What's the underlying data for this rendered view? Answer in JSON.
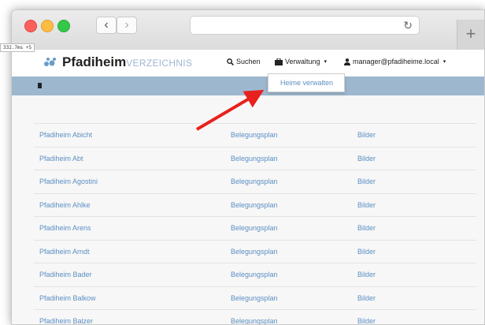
{
  "timing": "332.7ms +5",
  "logo": {
    "main": "Pfadiheim",
    "sub": "VERZEICHNIS"
  },
  "nav": {
    "search": "Suchen",
    "admin": "Verwaltung",
    "user": "manager@pfadiheime.local"
  },
  "dropdown": {
    "item": "Heime verwalten"
  },
  "rows": [
    {
      "name": "Pfadiheim Abicht",
      "plan": "Belegungsplan",
      "pics": "Bilder"
    },
    {
      "name": "Pfadiheim Abt",
      "plan": "Belegungsplan",
      "pics": "Bilder"
    },
    {
      "name": "Pfadiheim Agostini",
      "plan": "Belegungsplan",
      "pics": "Bilder"
    },
    {
      "name": "Pfadiheim Ahlke",
      "plan": "Belegungsplan",
      "pics": "Bilder"
    },
    {
      "name": "Pfadiheim Arens",
      "plan": "Belegungsplan",
      "pics": "Bilder"
    },
    {
      "name": "Pfadiheim Arndt",
      "plan": "Belegungsplan",
      "pics": "Bilder"
    },
    {
      "name": "Pfadiheim Bader",
      "plan": "Belegungsplan",
      "pics": "Bilder"
    },
    {
      "name": "Pfadiheim Balkow",
      "plan": "Belegungsplan",
      "pics": "Bilder"
    },
    {
      "name": "Pfadiheim Balzer",
      "plan": "Belegungsplan",
      "pics": "Bilder"
    }
  ],
  "colors": {
    "link": "#5b8fc3",
    "bar": "#9db7cf",
    "arrow": "#e8211e"
  },
  "icons": {
    "search": "search-icon",
    "admin": "briefcase-icon",
    "user": "user-icon"
  }
}
